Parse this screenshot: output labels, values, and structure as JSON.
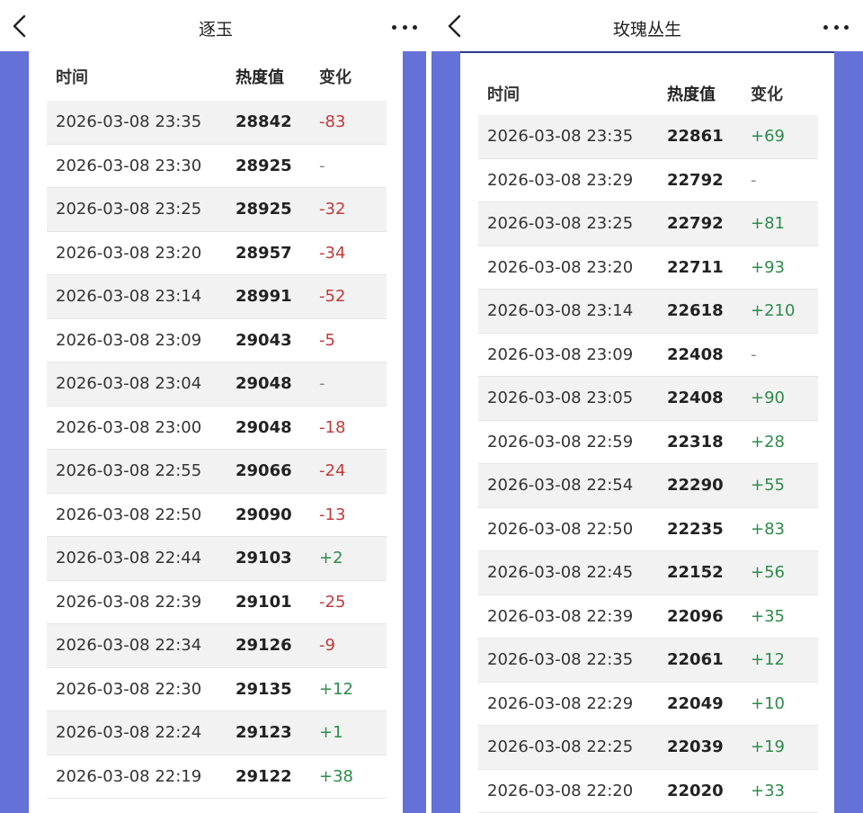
{
  "left": {
    "title": "逐玉",
    "columns": {
      "time": "时间",
      "value": "热度值",
      "change": "变化"
    },
    "rows": [
      {
        "time": "2026-03-08 23:35",
        "value": "28842",
        "change": "-83",
        "dir": "down"
      },
      {
        "time": "2026-03-08 23:30",
        "value": "28925",
        "change": "-",
        "dir": "none"
      },
      {
        "time": "2026-03-08 23:25",
        "value": "28925",
        "change": "-32",
        "dir": "down"
      },
      {
        "time": "2026-03-08 23:20",
        "value": "28957",
        "change": "-34",
        "dir": "down"
      },
      {
        "time": "2026-03-08 23:14",
        "value": "28991",
        "change": "-52",
        "dir": "down"
      },
      {
        "time": "2026-03-08 23:09",
        "value": "29043",
        "change": "-5",
        "dir": "down"
      },
      {
        "time": "2026-03-08 23:04",
        "value": "29048",
        "change": "-",
        "dir": "none"
      },
      {
        "time": "2026-03-08 23:00",
        "value": "29048",
        "change": "-18",
        "dir": "down"
      },
      {
        "time": "2026-03-08 22:55",
        "value": "29066",
        "change": "-24",
        "dir": "down"
      },
      {
        "time": "2026-03-08 22:50",
        "value": "29090",
        "change": "-13",
        "dir": "down"
      },
      {
        "time": "2026-03-08 22:44",
        "value": "29103",
        "change": "+2",
        "dir": "up"
      },
      {
        "time": "2026-03-08 22:39",
        "value": "29101",
        "change": "-25",
        "dir": "down"
      },
      {
        "time": "2026-03-08 22:34",
        "value": "29126",
        "change": "-9",
        "dir": "down"
      },
      {
        "time": "2026-03-08 22:30",
        "value": "29135",
        "change": "+12",
        "dir": "up"
      },
      {
        "time": "2026-03-08 22:24",
        "value": "29123",
        "change": "+1",
        "dir": "up"
      },
      {
        "time": "2026-03-08 22:19",
        "value": "29122",
        "change": "+38",
        "dir": "up"
      }
    ]
  },
  "right": {
    "title": "玫瑰丛生",
    "columns": {
      "time": "时间",
      "value": "热度值",
      "change": "变化"
    },
    "rows": [
      {
        "time": "2026-03-08 23:35",
        "value": "22861",
        "change": "+69",
        "dir": "up"
      },
      {
        "time": "2026-03-08 23:29",
        "value": "22792",
        "change": "-",
        "dir": "none"
      },
      {
        "time": "2026-03-08 23:25",
        "value": "22792",
        "change": "+81",
        "dir": "up"
      },
      {
        "time": "2026-03-08 23:20",
        "value": "22711",
        "change": "+93",
        "dir": "up"
      },
      {
        "time": "2026-03-08 23:14",
        "value": "22618",
        "change": "+210",
        "dir": "up"
      },
      {
        "time": "2026-03-08 23:09",
        "value": "22408",
        "change": "-",
        "dir": "none"
      },
      {
        "time": "2026-03-08 23:05",
        "value": "22408",
        "change": "+90",
        "dir": "up"
      },
      {
        "time": "2026-03-08 22:59",
        "value": "22318",
        "change": "+28",
        "dir": "up"
      },
      {
        "time": "2026-03-08 22:54",
        "value": "22290",
        "change": "+55",
        "dir": "up"
      },
      {
        "time": "2026-03-08 22:50",
        "value": "22235",
        "change": "+83",
        "dir": "up"
      },
      {
        "time": "2026-03-08 22:45",
        "value": "22152",
        "change": "+56",
        "dir": "up"
      },
      {
        "time": "2026-03-08 22:39",
        "value": "22096",
        "change": "+35",
        "dir": "up"
      },
      {
        "time": "2026-03-08 22:35",
        "value": "22061",
        "change": "+12",
        "dir": "up"
      },
      {
        "time": "2026-03-08 22:29",
        "value": "22049",
        "change": "+10",
        "dir": "up"
      },
      {
        "time": "2026-03-08 22:25",
        "value": "22039",
        "change": "+19",
        "dir": "up"
      },
      {
        "time": "2026-03-08 22:20",
        "value": "22020",
        "change": "+33",
        "dir": "up"
      }
    ]
  },
  "icons": {
    "back": "chevron-left-icon",
    "more": "more-horizontal-icon"
  },
  "colors": {
    "background_band": "#6471d6",
    "increase": "#2e8b4a",
    "decrease": "#c0393b",
    "neutral": "#888888",
    "row_shade": "#f2f2f2"
  }
}
